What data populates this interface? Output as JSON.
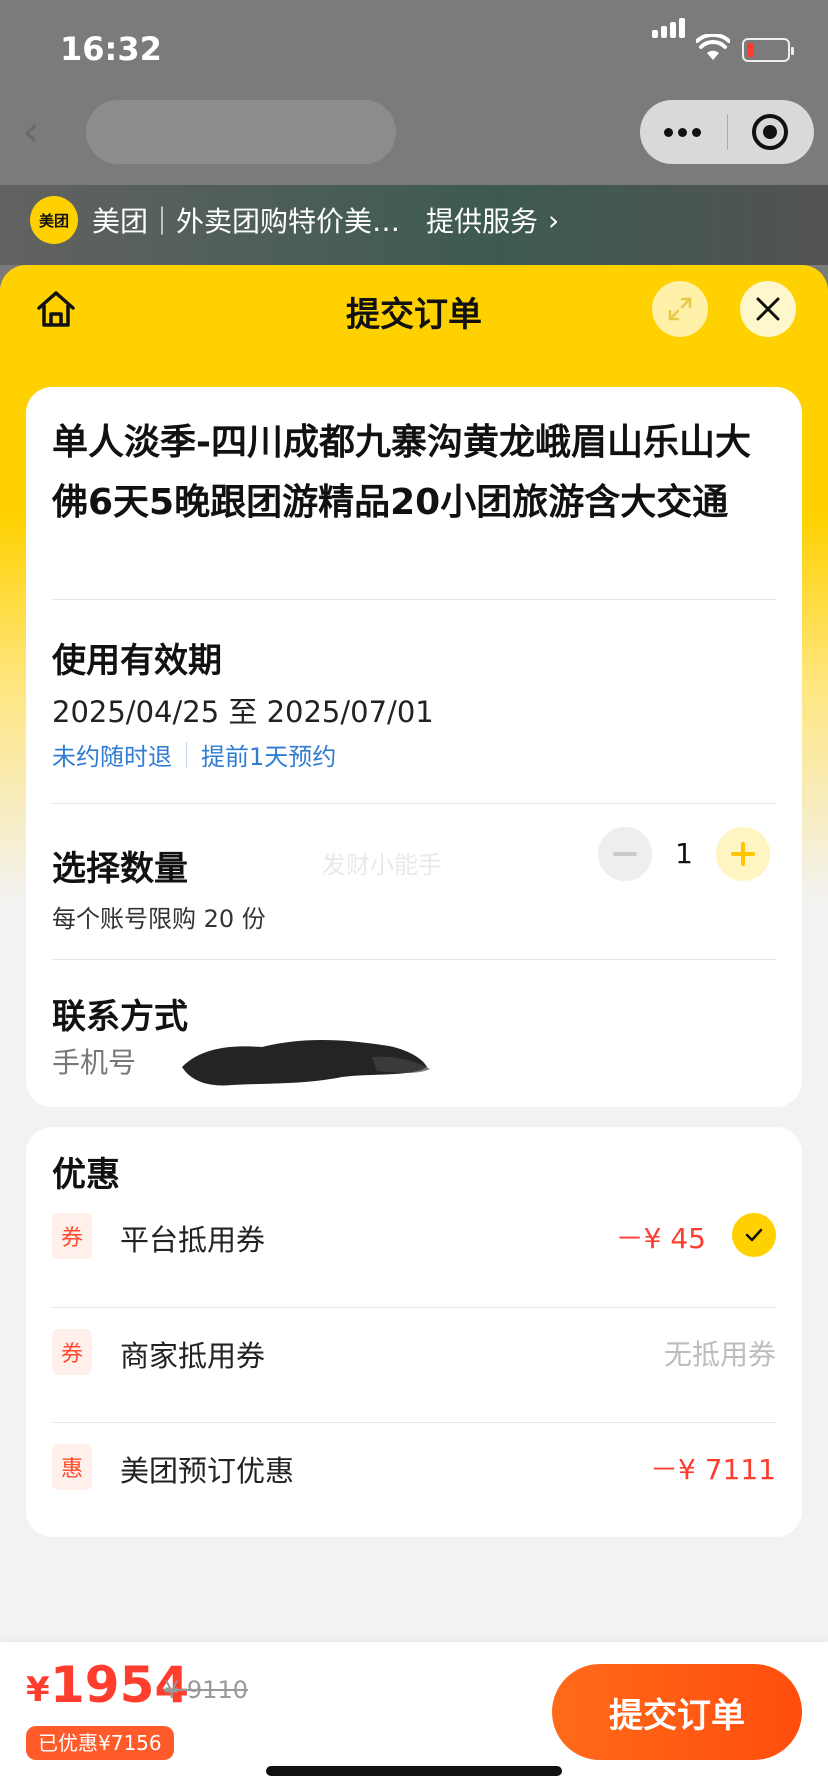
{
  "status_bar": {
    "time": "16:32"
  },
  "provider": {
    "logo_text": "美团",
    "name": "美团｜外卖团购特价美…",
    "service_label": "提供服务",
    "chevron": "chevron-right-icon"
  },
  "sheet": {
    "title": "提交订单"
  },
  "product": {
    "title": "单人淡季-四川成都九寨沟黄龙峨眉山乐山大佛6天5晚跟团游精品20小团旅游含大交通"
  },
  "validity": {
    "title": "使用有效期",
    "date_range": "2025/04/25 至 2025/07/01",
    "tags": [
      "未约随时退",
      "提前1天预约"
    ]
  },
  "quantity": {
    "title": "选择数量",
    "value": "1",
    "limit_text": "每个账号限购 20 份",
    "watermark": "发财小能手"
  },
  "contact": {
    "title": "联系方式",
    "phone_label": "手机号"
  },
  "discounts": {
    "title": "优惠",
    "items": [
      {
        "badge": "券",
        "label": "平台抵用券",
        "amount": "－¥ 45",
        "checked": true
      },
      {
        "badge": "券",
        "label": "商家抵用券",
        "amount": "无抵用券"
      },
      {
        "badge": "惠",
        "label": "美团预订优惠",
        "amount": "－¥ 7111"
      }
    ]
  },
  "footer": {
    "currency": "¥",
    "price": "1954",
    "original_price": "¥ 9110",
    "saved_label": "已优惠¥7156",
    "submit_label": "提交订单"
  },
  "colors": {
    "brand_yellow": "#ffd100",
    "accent_orange": "#ff5a1f",
    "price_red": "#ff3d2e",
    "link_blue": "#2f7cd3"
  }
}
